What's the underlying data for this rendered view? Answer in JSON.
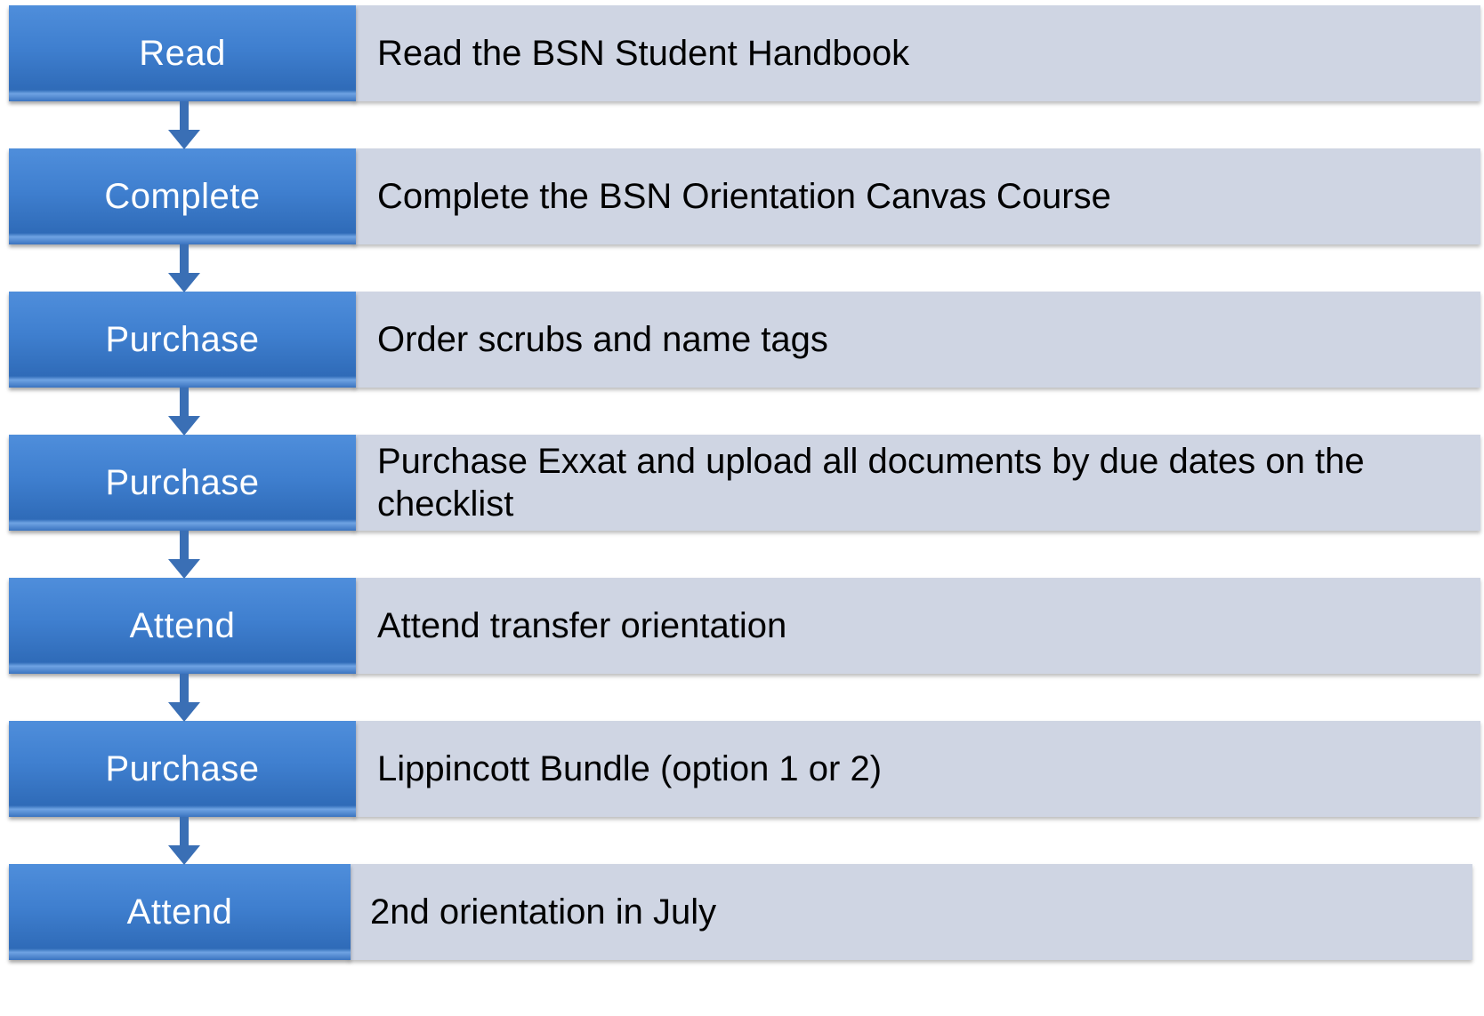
{
  "steps": [
    {
      "label": "Read",
      "description": "Read the BSN Student Handbook"
    },
    {
      "label": "Complete",
      "description": "Complete the BSN Orientation Canvas Course"
    },
    {
      "label": "Purchase",
      "description": "Order scrubs and name tags"
    },
    {
      "label": "Purchase",
      "description": "Purchase Exxat and upload all documents by due dates on the checklist"
    },
    {
      "label": "Attend",
      "description": "Attend transfer orientation"
    },
    {
      "label": "Purchase",
      "description": "Lippincott Bundle (option 1 or 2)"
    },
    {
      "label": "Attend",
      "description": "2nd orientation in July"
    }
  ],
  "colors": {
    "label_box": "#3f7fcf",
    "description_box": "#cfd5e3",
    "arrow": "#3a6fb5"
  }
}
